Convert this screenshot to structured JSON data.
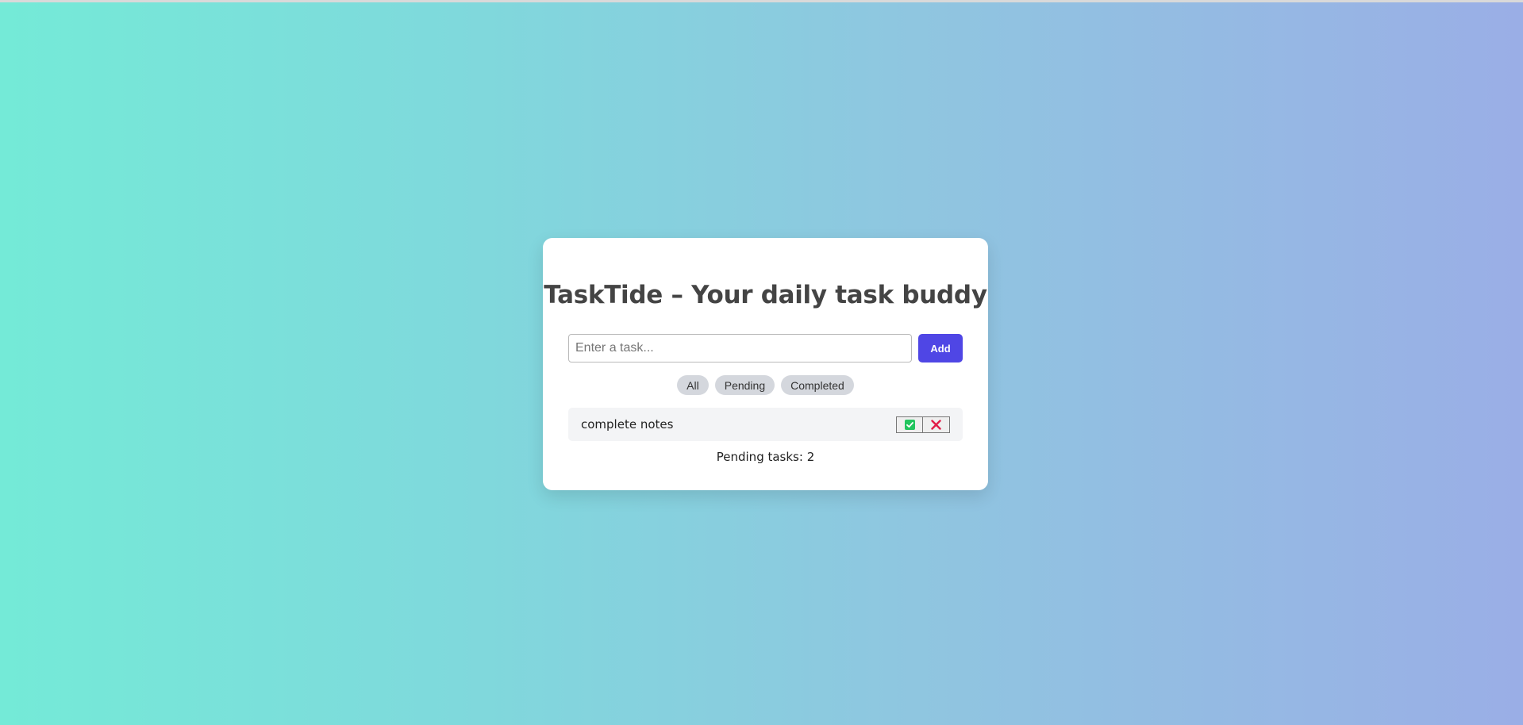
{
  "app": {
    "title": "TaskTide – Your daily task buddy"
  },
  "input": {
    "value": "",
    "placeholder": "Enter a task..."
  },
  "add_button": {
    "label": "Add"
  },
  "filters": [
    {
      "label": "All"
    },
    {
      "label": "Pending"
    },
    {
      "label": "Completed"
    }
  ],
  "tasks": [
    {
      "text": "complete notes",
      "complete_icon": "check-square-icon",
      "delete_icon": "close-icon"
    }
  ],
  "status": {
    "text": "Pending tasks: 2"
  },
  "colors": {
    "accent": "#4f46e5",
    "complete": "#22c55e",
    "delete": "#e11d48"
  }
}
